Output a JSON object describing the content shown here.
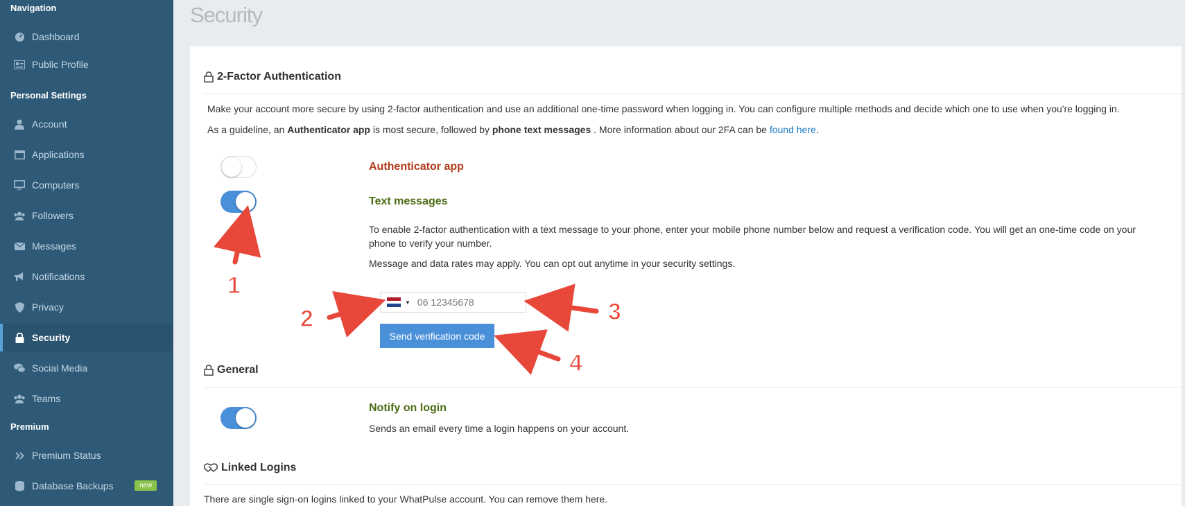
{
  "sidebar": {
    "sections": [
      {
        "label": "Navigation"
      },
      {
        "label": "Personal Settings"
      },
      {
        "label": "Premium"
      }
    ],
    "items": [
      {
        "label": "Dashboard",
        "icon": "dashboard-icon"
      },
      {
        "label": "Public Profile",
        "icon": "id-card-icon"
      },
      {
        "label": "Account",
        "icon": "user-icon"
      },
      {
        "label": "Applications",
        "icon": "window-icon"
      },
      {
        "label": "Computers",
        "icon": "monitor-icon"
      },
      {
        "label": "Followers",
        "icon": "users-icon"
      },
      {
        "label": "Messages",
        "icon": "envelope-icon"
      },
      {
        "label": "Notifications",
        "icon": "megaphone-icon"
      },
      {
        "label": "Privacy",
        "icon": "shield-icon"
      },
      {
        "label": "Security",
        "icon": "lock-icon",
        "active": true
      },
      {
        "label": "Social Media",
        "icon": "chat-icon"
      },
      {
        "label": "Teams",
        "icon": "users-icon"
      },
      {
        "label": "Premium Status",
        "icon": "double-chevron-icon"
      },
      {
        "label": "Database Backups",
        "icon": "database-icon",
        "badge": "new"
      }
    ]
  },
  "page": {
    "title": "Security"
  },
  "twofa": {
    "heading": "2-Factor Authentication",
    "intro": "Make your account more secure by using 2-factor authentication and use an additional one-time password when logging in. You can configure multiple methods and decide which one to use when you're logging in.",
    "guide_pre": "As a guideline, an ",
    "guide_b1": "Authenticator app",
    "guide_mid": " is most secure, followed by ",
    "guide_b2": "phone text messages",
    "guide_post": " . More information about our 2FA can be ",
    "guide_link": "found here",
    "guide_end": ".",
    "authenticator": {
      "label": "Authenticator app",
      "enabled": false,
      "color": "#b03a1a"
    },
    "text_messages": {
      "label": "Text messages",
      "enabled": true,
      "color": "#4c6b12",
      "desc": "To enable 2-factor authentication with a text message to your phone, enter your mobile phone number below and request a verification code. You will get an one-time code on your phone to verify your number.",
      "rates": "Message and data rates may apply. You can opt out anytime in your security settings.",
      "phone_placeholder": "06 12345678",
      "country_flag": "netherlands-flag-icon",
      "send_label": "Send verification code"
    }
  },
  "general": {
    "heading": "General",
    "notify": {
      "label": "Notify on login",
      "enabled": true,
      "desc": "Sends an email every time a login happens on your account."
    }
  },
  "linked": {
    "heading": "Linked Logins",
    "desc": "There are single sign-on logins linked to your WhatPulse account. You can remove them here."
  },
  "annotations": [
    "1",
    "2",
    "3",
    "4"
  ],
  "colors": {
    "accent": "#4a90d9",
    "sidebar": "#2e5a78",
    "arrow": "#e8483a"
  }
}
